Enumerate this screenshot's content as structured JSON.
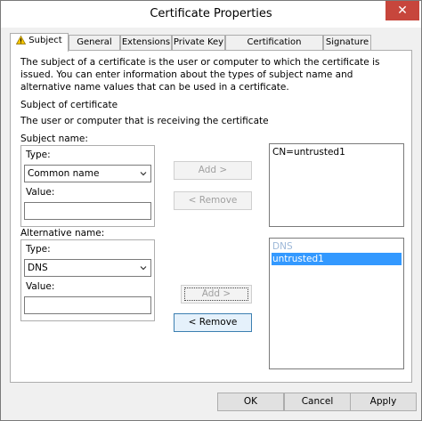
{
  "window": {
    "title": "Certificate Properties",
    "close_glyph": "✕"
  },
  "tabs": [
    {
      "label": "Subject",
      "icon": "warning-icon",
      "active": true
    },
    {
      "label": "General"
    },
    {
      "label": "Extensions"
    },
    {
      "label": "Private Key"
    },
    {
      "label": "Certification Authority"
    },
    {
      "label": "Signature"
    }
  ],
  "subject": {
    "description": "The subject of a certificate is the user or computer to which the certificate is issued. You can enter information about the types of subject name and alternative name values that can be used in a certificate.",
    "heading": "Subject of certificate",
    "subheading": "The user or computer that is receiving the certificate",
    "subject_name": {
      "group_label": "Subject name:",
      "type_label": "Type:",
      "type_value": "Common name",
      "value_label": "Value:",
      "value": "",
      "add_label": "Add >",
      "remove_label": "< Remove",
      "list_items": [
        "CN=untrusted1"
      ]
    },
    "alternative_name": {
      "group_label": "Alternative name:",
      "type_label": "Type:",
      "type_value": "DNS",
      "value_label": "Value:",
      "value": "",
      "add_label": "Add >",
      "remove_label": "< Remove",
      "list_header": "DNS",
      "list_items": [
        "untrusted1"
      ]
    }
  },
  "footer": {
    "ok_label": "OK",
    "cancel_label": "Cancel",
    "apply_label": "Apply"
  },
  "colors": {
    "selection": "#3399ff",
    "close": "#c7463c",
    "warning": "#f2c200"
  }
}
